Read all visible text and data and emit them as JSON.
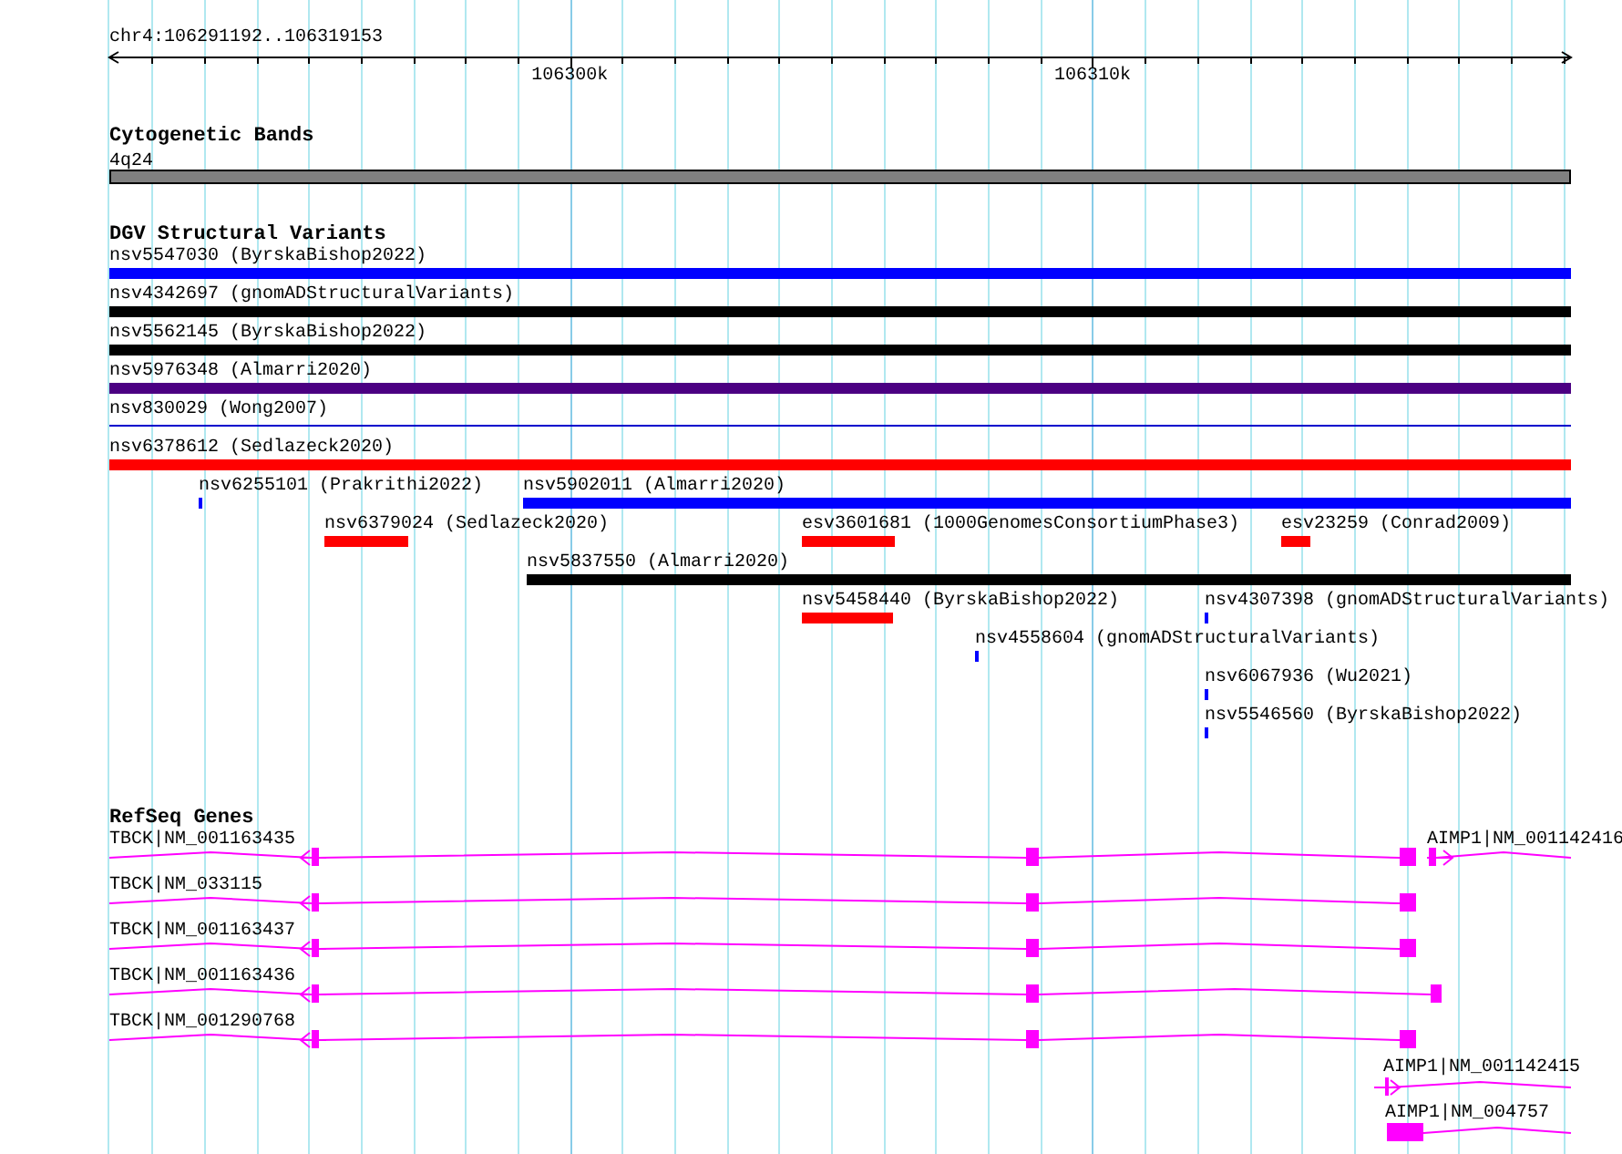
{
  "ruler": {
    "range_label": "chr4:106291192..106319153",
    "ticks": [
      "106300k",
      "106310k"
    ]
  },
  "tracks": [
    {
      "kind": "cytoband",
      "title": "Cytogenetic Bands",
      "features": [
        {
          "label": "4q24",
          "color": "#808080"
        }
      ]
    },
    {
      "kind": "variant",
      "title": "DGV Structural Variants",
      "features": [
        {
          "label": "nsv5547030 (ByrskaBishop2022)",
          "color": "#0000ff"
        },
        {
          "label": "nsv4342697 (gnomADStructuralVariants)",
          "color": "#000000"
        },
        {
          "label": "nsv5562145 (ByrskaBishop2022)",
          "color": "#000000"
        },
        {
          "label": "nsv5976348 (Almarri2020)",
          "color": "#4b0082"
        },
        {
          "label": "nsv830029 (Wong2007)",
          "color": "#0000cc"
        },
        {
          "label": "nsv6378612 (Sedlazeck2020)",
          "color": "#ff0000"
        },
        {
          "label": "nsv6255101 (Prakrithi2022)",
          "color": "#0000ff"
        },
        {
          "label": "nsv5902011 (Almarri2020)",
          "color": "#0000ff"
        },
        {
          "label": "nsv6379024 (Sedlazeck2020)",
          "color": "#ff0000"
        },
        {
          "label": "esv3601681 (1000GenomesConsortiumPhase3)",
          "color": "#ff0000"
        },
        {
          "label": "esv23259 (Conrad2009)",
          "color": "#ff0000"
        },
        {
          "label": "nsv5837550 (Almarri2020)",
          "color": "#000000"
        },
        {
          "label": "nsv5458440 (ByrskaBishop2022)",
          "color": "#ff0000"
        },
        {
          "label": "nsv4307398 (gnomADStructuralVariants)",
          "color": "#0000ff"
        },
        {
          "label": "nsv4558604 (gnomADStructuralVariants)",
          "color": "#0000ff"
        },
        {
          "label": "nsv6067936 (Wu2021)",
          "color": "#0000ff"
        },
        {
          "label": "nsv5546560 (ByrskaBishop2022)",
          "color": "#0000ff"
        }
      ]
    },
    {
      "kind": "gene",
      "title": "RefSeq Genes",
      "features": [
        {
          "label": "TBCK|NM_001163435",
          "reverse_strand": true
        },
        {
          "label": "TBCK|NM_033115",
          "reverse_strand": true
        },
        {
          "label": "TBCK|NM_001163437",
          "reverse_strand": true
        },
        {
          "label": "TBCK|NM_001163436",
          "reverse_strand": true
        },
        {
          "label": "TBCK|NM_001290768",
          "reverse_strand": true
        },
        {
          "label": "AIMP1|NM_001142416",
          "reverse_strand": false
        },
        {
          "label": "AIMP1|NM_001142415",
          "reverse_strand": false
        },
        {
          "label": "AIMP1|NM_004757"
        }
      ]
    }
  ]
}
